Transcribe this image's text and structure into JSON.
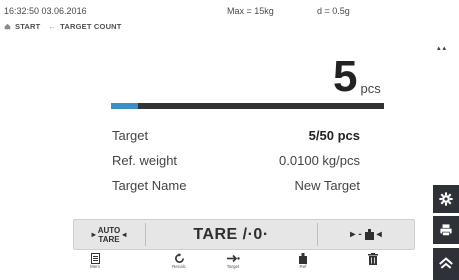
{
  "status": {
    "datetime": "16:32:50 03.06.2016",
    "max": "Max = 15kg",
    "division": "d = 0.5g"
  },
  "breadcrumb": {
    "start": "START",
    "separator": "←",
    "current": "TARGET COUNT"
  },
  "reading": {
    "value": "5",
    "unit": "pcs"
  },
  "progress": {
    "value": 0.1,
    "color_fill": "#3a90c6",
    "color_track": "#333333"
  },
  "info": {
    "rows": [
      {
        "label": "Target",
        "value": "5/50 pcs"
      },
      {
        "label": "Ref. weight",
        "value": "0.0100 kg/pcs"
      },
      {
        "label": "Target Name",
        "value": "New Target"
      }
    ]
  },
  "buttons": {
    "auto_tare_line1": "AUTO",
    "auto_tare_line2": "TARE",
    "tare_zero": "TARE /·0·"
  },
  "toolbar": {
    "mem": "Mem",
    "recalc": "Recalc",
    "target": "Target",
    "ref": "Ref"
  },
  "icons": {
    "settings": "gear-icon",
    "print": "printer-icon",
    "home": "home-icon",
    "delete": "trash-icon"
  },
  "colors": {
    "side_button_bg": "#2e3238",
    "button_bar_bg": "#e6e6e6"
  }
}
